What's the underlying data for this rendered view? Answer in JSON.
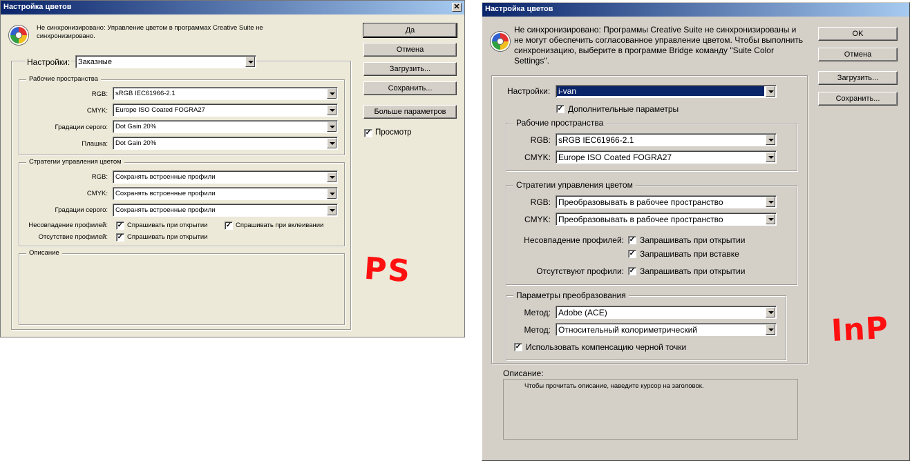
{
  "ps": {
    "title": "Настройка цветов",
    "close": "✕",
    "message": "Не синхронизировано: Управление цветом в программах Creative Suite не синхронизировано.",
    "settings_label": "Настройки:",
    "settings_value": "Заказные",
    "workspaces": {
      "title": "Рабочие пространства",
      "rgb_label": "RGB:",
      "rgb": "sRGB IEC61966-2.1",
      "cmyk_label": "CMYK:",
      "cmyk": "Europe ISO Coated FOGRA27",
      "gray_label": "Градации серого:",
      "gray": "Dot Gain 20%",
      "spot_label": "Плашка:",
      "spot": "Dot Gain 20%"
    },
    "policies": {
      "title": "Стратегии управления цветом",
      "rgb_label": "RGB:",
      "rgb": "Сохранять встроенные профили",
      "cmyk_label": "CMYK:",
      "cmyk": "Сохранять встроенные профили",
      "gray_label": "Градации серого:",
      "gray": "Сохранять встроенные профили",
      "mismatch_label": "Несовпадение профилей:",
      "ask_open": "Спрашивать при открытии",
      "ask_paste": "Спрашивать при вклеивании",
      "missing_label": "Отсутствие профилей:",
      "missing_ask_open": "Спрашивать при открытии"
    },
    "description_title": "Описание",
    "buttons": {
      "ok": "Да",
      "cancel": "Отмена",
      "load": "Загрузить...",
      "save": "Сохранить...",
      "more": "Больше параметров"
    },
    "preview": "Просмотр",
    "check": "✓",
    "annotation": "PS"
  },
  "id": {
    "title": "Настройка цветов",
    "message": "Не синхронизировано: Программы Creative Suite не синхронизированы и не могут обеспечить согласованное управление цветом. Чтобы выполнить синхронизацию, выберите в программе Bridge команду \"Suite Color Settings\".",
    "settings_label": "Настройки:",
    "settings_value": "i-van",
    "advanced": "Дополнительные параметры",
    "workspaces": {
      "title": "Рабочие пространства",
      "rgb_label": "RGB:",
      "rgb": "sRGB IEC61966-2.1",
      "cmyk_label": "CMYK:",
      "cmyk": "Europe ISO Coated FOGRA27"
    },
    "policies": {
      "title": "Стратегии управления цветом",
      "rgb_label": "RGB:",
      "rgb": "Преобразовывать в рабочее пространство",
      "cmyk_label": "CMYK:",
      "cmyk": "Преобразовывать в рабочее пространство",
      "mismatch_label": "Несовпадение профилей:",
      "ask_open": "Запрашивать при открытии",
      "ask_paste": "Запрашивать при вставке",
      "missing_label": "Отсутствуют профили:",
      "missing_ask_open": "Запрашивать при открытии"
    },
    "conversion": {
      "title": "Параметры преобразования",
      "engine_label": "Метод:",
      "engine": "Adobe (ACE)",
      "intent_label": "Метод:",
      "intent": "Относительный колориметрический",
      "bpc": "Использовать компенсацию черной точки"
    },
    "description_label": "Описание:",
    "description_text": "Чтобы прочитать описание, наведите курсор на заголовок.",
    "buttons": {
      "ok": "OK",
      "cancel": "Отмена",
      "load": "Загрузить...",
      "save": "Сохранить..."
    },
    "check": "✓",
    "annotation": "InP"
  },
  "colors": {
    "dialog_bg": "#ece9d8",
    "dialog2_bg": "#d4d0c8",
    "title_start": "#0a246a",
    "annotation": "#ff1010",
    "selection": "#0a246a"
  }
}
